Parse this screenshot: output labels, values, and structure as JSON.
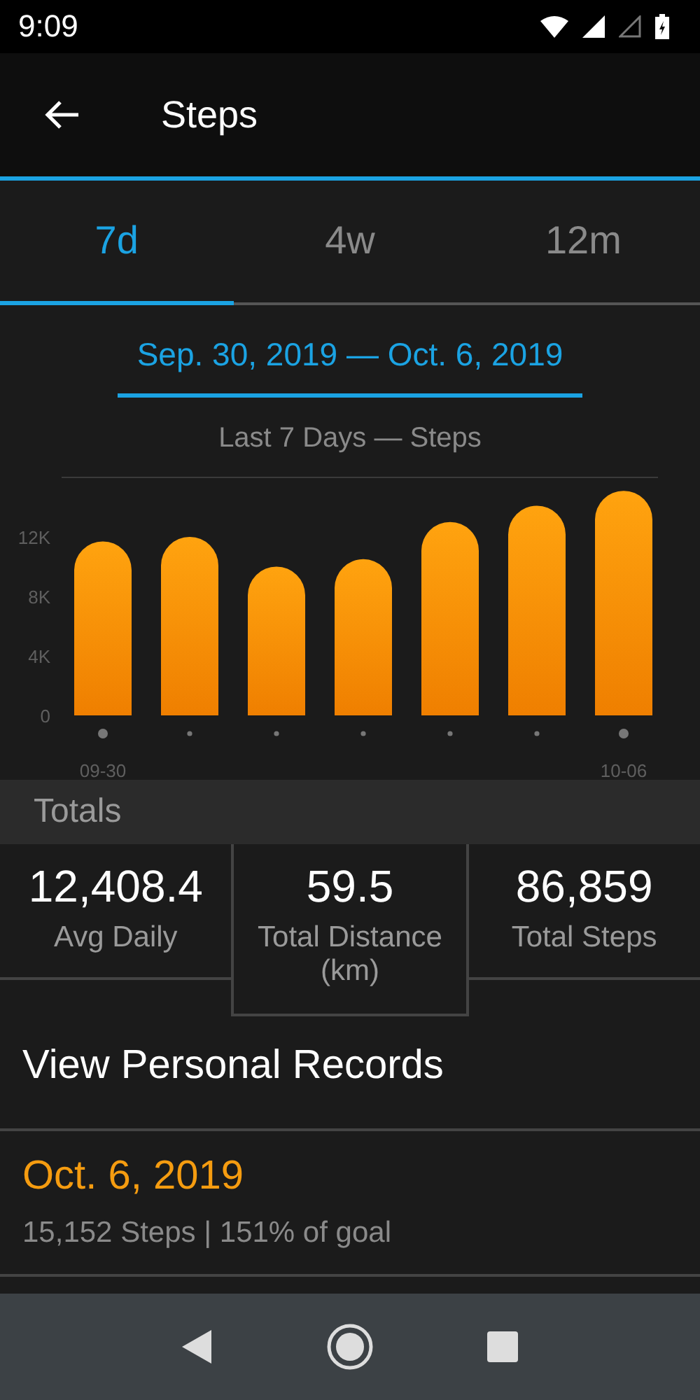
{
  "status_bar": {
    "time": "9:09"
  },
  "app_bar": {
    "title": "Steps"
  },
  "tabs": [
    {
      "label": "7d",
      "selected": true
    },
    {
      "label": "4w",
      "selected": false
    },
    {
      "label": "12m",
      "selected": false
    }
  ],
  "date_range": "Sep. 30, 2019 — Oct. 6, 2019",
  "chart": {
    "chart_data": {
      "type": "bar",
      "title": "Last 7 Days — Steps",
      "values": [
        11700,
        12000,
        10000,
        10500,
        13000,
        14100,
        15100
      ],
      "ylim": [
        0,
        16000
      ],
      "yticks": [
        {
          "value": 0,
          "label": "0"
        },
        {
          "value": 4000,
          "label": "4K"
        },
        {
          "value": 8000,
          "label": "8K"
        },
        {
          "value": 12000,
          "label": "12K"
        }
      ],
      "categories": [
        "09-30",
        null,
        null,
        null,
        null,
        null,
        "10-06"
      ]
    }
  },
  "totals": {
    "header": "Totals",
    "stats": [
      {
        "value": "12,408.4",
        "label": "Avg Daily",
        "boxed": false
      },
      {
        "value": "59.5",
        "label": "Total Distance (km)",
        "boxed": true
      },
      {
        "value": "86,859",
        "label": "Total Steps",
        "boxed": false
      }
    ]
  },
  "records_link": "View Personal Records",
  "record": {
    "date": "Oct. 6, 2019",
    "detail": "15,152 Steps | 151% of goal"
  }
}
